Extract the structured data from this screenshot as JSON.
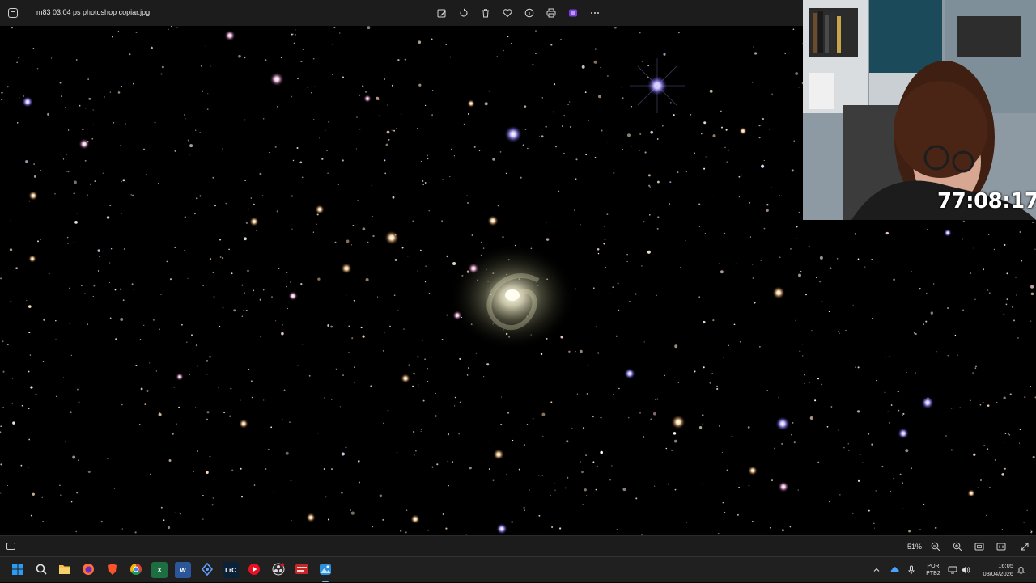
{
  "window": {
    "file_name": "m83  03.04 ps photoshop copiar.jpg"
  },
  "toolbar": {
    "buttons": [
      {
        "name": "edit-image-button",
        "icon": "edit-icon"
      },
      {
        "name": "rotate-button",
        "icon": "rotate-icon"
      },
      {
        "name": "delete-button",
        "icon": "trash-icon"
      },
      {
        "name": "favorite-button",
        "icon": "heart-icon"
      },
      {
        "name": "info-button",
        "icon": "info-icon"
      },
      {
        "name": "print-button",
        "icon": "printer-icon"
      },
      {
        "name": "clipchamp-button",
        "icon": "clipchamp-icon"
      },
      {
        "name": "more-options-button",
        "icon": "ellipsis-icon"
      }
    ]
  },
  "overlay": {
    "timer": "77:08:17"
  },
  "statusbar": {
    "zoom": "51%"
  },
  "taskbar": {
    "apps": [
      {
        "name": "start-button",
        "icon": "windows-icon",
        "color": "#1e90ff",
        "label": ""
      },
      {
        "name": "search-button",
        "icon": "search-icon",
        "color": "",
        "label": ""
      },
      {
        "name": "file-explorer-app",
        "icon": "folder-icon",
        "color": "#f2c14e",
        "label": ""
      },
      {
        "name": "firefox-app",
        "icon": "firefox-icon",
        "color": "#ff7139",
        "label": ""
      },
      {
        "name": "brave-app",
        "icon": "brave-icon",
        "color": "#fb542b",
        "label": ""
      },
      {
        "name": "chrome-app",
        "icon": "chrome-icon",
        "color": "#34a853",
        "label": ""
      },
      {
        "name": "excel-app",
        "icon": "excel-icon",
        "color": "#1d6f42",
        "label": "X"
      },
      {
        "name": "word-app",
        "icon": "word-icon",
        "color": "#2b579a",
        "label": "W"
      },
      {
        "name": "pen-app",
        "icon": "pen-tool-icon",
        "color": "#3b82f6",
        "label": ""
      },
      {
        "name": "lightroom-app",
        "icon": "lightroom-icon",
        "color": "#0b2138",
        "label": "LrC"
      },
      {
        "name": "media-player-app",
        "icon": "play-icon",
        "color": "#e81123",
        "label": ""
      },
      {
        "name": "obs-app",
        "icon": "obs-icon",
        "color": "#333333",
        "label": ""
      },
      {
        "name": "streaming-app",
        "icon": "streaming-icon",
        "color": "#c62828",
        "label": ""
      },
      {
        "name": "photos-app",
        "icon": "photos-icon",
        "color": "#2f8fd8",
        "label": ""
      }
    ],
    "language": [
      "POR",
      "PTB2"
    ],
    "time": "16:05",
    "date": "08/04/2026"
  }
}
